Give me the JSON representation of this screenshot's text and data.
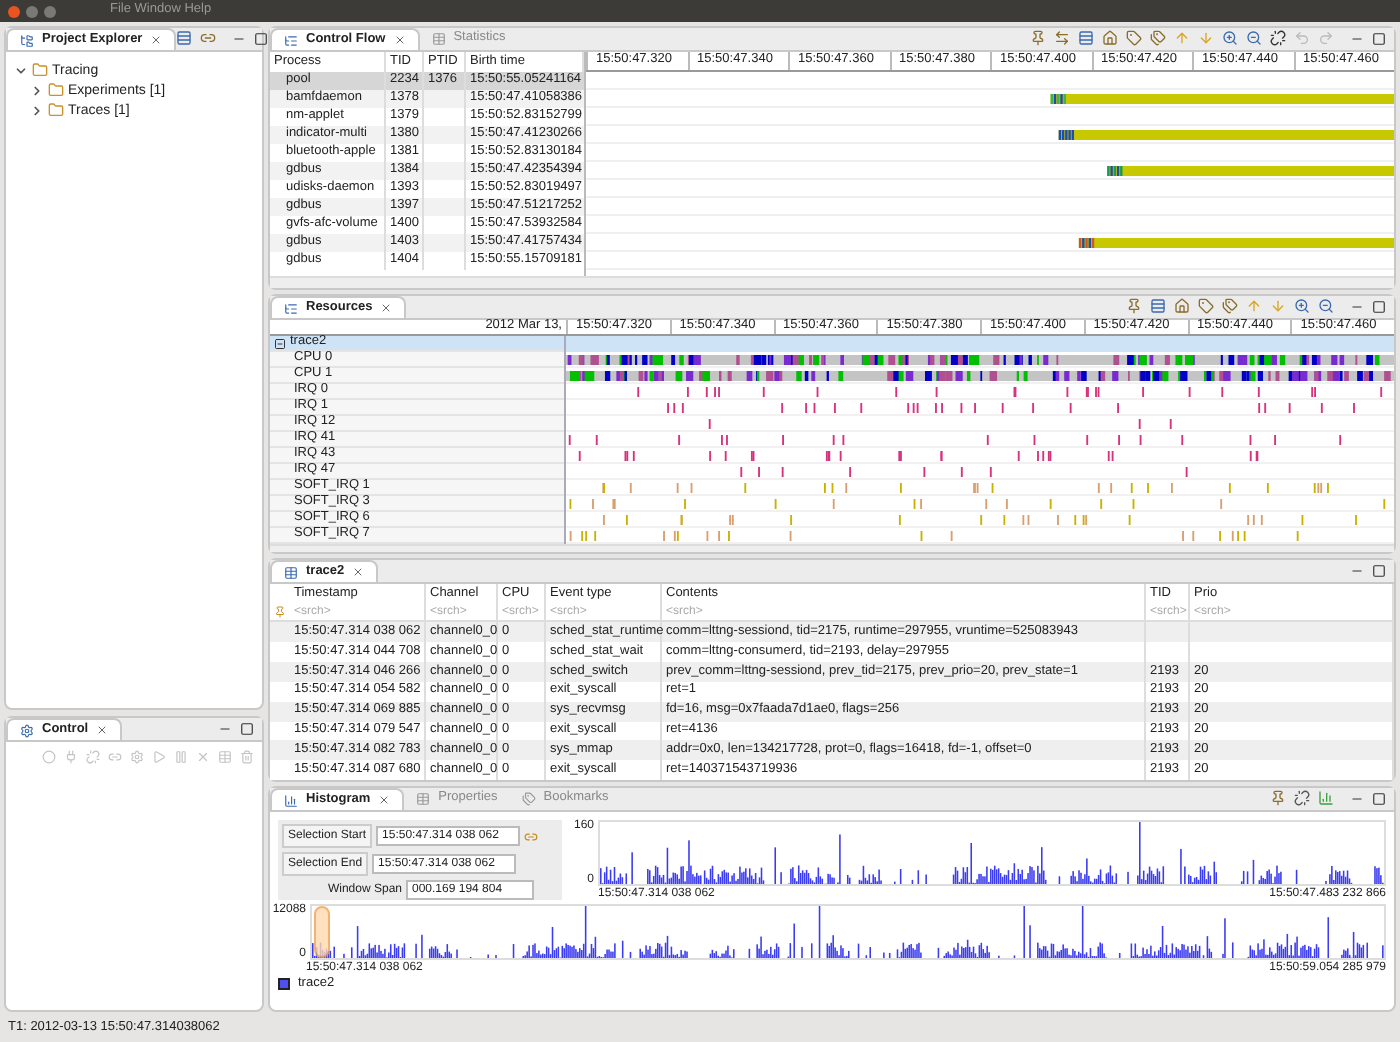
{
  "window": {
    "title": "File Window Help"
  },
  "project_explorer": {
    "title": "Project Explorer",
    "tree": [
      {
        "label": "Tracing",
        "expanded": true,
        "children": [
          {
            "label": "Experiments [1]",
            "expanded": false
          },
          {
            "label": "Traces [1]",
            "expanded": false
          }
        ]
      }
    ]
  },
  "control_view": {
    "title": "Control"
  },
  "control_flow": {
    "tabs": [
      {
        "label": "Control Flow",
        "selected": true
      },
      {
        "label": "Statistics",
        "selected": false
      }
    ],
    "columns": [
      "Process",
      "TID",
      "PTID",
      "Birth time"
    ],
    "rows": [
      {
        "process": "pool",
        "tid": "2234",
        "ptid": "1376",
        "birth": "15:50:55.05241164",
        "selected": true
      },
      {
        "process": "bamfdaemon",
        "tid": "1378",
        "birth": "15:50:47.41058386",
        "selected": false
      },
      {
        "process": "nm-applet",
        "tid": "1379",
        "birth": "15:50:52.83152799",
        "selected": false
      },
      {
        "process": "indicator-multi",
        "tid": "1380",
        "birth": "15:50:47.41230266",
        "selected": false
      },
      {
        "process": "bluetooth-apple",
        "tid": "1381",
        "birth": "15:50:52.83130184",
        "selected": false
      },
      {
        "process": "gdbus",
        "tid": "1384",
        "birth": "15:50:47.42354394",
        "selected": false
      },
      {
        "process": "udisks-daemon",
        "tid": "1393",
        "birth": "15:50:52.83019497",
        "selected": false
      },
      {
        "process": "gdbus",
        "tid": "1397",
        "birth": "15:50:47.51217252",
        "selected": false
      },
      {
        "process": "gvfs-afc-volume",
        "tid": "1400",
        "birth": "15:50:47.53932584",
        "selected": false
      },
      {
        "process": "gdbus",
        "tid": "1403",
        "birth": "15:50:47.41757434",
        "selected": false
      },
      {
        "process": "gdbus",
        "tid": "1404",
        "birth": "15:50:55.15709181",
        "selected": false
      }
    ],
    "time_axis": [
      "15:50:47.320",
      "15:50:47.340",
      "15:50:47.360",
      "15:50:47.380",
      "15:50:47.400",
      "15:50:47.420",
      "15:50:47.440",
      "15:50:47.460"
    ]
  },
  "resources": {
    "title": "Resources",
    "date_label": "2012 Mar 13,",
    "time_axis": [
      "15:50:47.320",
      "15:50:47.340",
      "15:50:47.360",
      "15:50:47.380",
      "15:50:47.400",
      "15:50:47.420",
      "15:50:47.440",
      "15:50:47.460"
    ],
    "rows": [
      {
        "label": "trace2",
        "kind": "group",
        "expanded": true,
        "selected": true
      },
      {
        "label": "CPU 0",
        "kind": "cpu",
        "selected": false
      },
      {
        "label": "CPU 1",
        "kind": "cpu",
        "selected": false
      },
      {
        "label": "IRQ 0",
        "kind": "irq",
        "selected": false
      },
      {
        "label": "IRQ 1",
        "kind": "irq",
        "selected": false
      },
      {
        "label": "IRQ 12",
        "kind": "irq",
        "selected": false
      },
      {
        "label": "IRQ 41",
        "kind": "irq",
        "selected": false
      },
      {
        "label": "IRQ 43",
        "kind": "irq",
        "selected": false
      },
      {
        "label": "IRQ 47",
        "kind": "irq",
        "selected": false
      },
      {
        "label": "SOFT_IRQ 1",
        "kind": "soft_irq",
        "selected": false
      },
      {
        "label": "SOFT_IRQ 3",
        "kind": "soft_irq",
        "selected": false
      },
      {
        "label": "SOFT_IRQ 6",
        "kind": "soft_irq",
        "selected": false
      },
      {
        "label": "SOFT_IRQ 7",
        "kind": "soft_irq",
        "selected": false
      }
    ]
  },
  "events": {
    "title": "trace2",
    "columns": [
      "Timestamp",
      "Channel",
      "CPU",
      "Event type",
      "Contents",
      "TID",
      "Prio"
    ],
    "filters": [
      {
        "placeholder": "<srch>"
      },
      {
        "placeholder": "<srch>"
      },
      {
        "placeholder": "<srch>"
      },
      {
        "placeholder": "<srch>"
      },
      {
        "placeholder": "<srch>"
      },
      {
        "placeholder": "<srch>"
      },
      {
        "placeholder": "<srch>"
      }
    ],
    "rows": [
      {
        "timestamp": "15:50:47.314 038 062",
        "channel": "channel0_0",
        "cpu": "0",
        "event_type": "sched_stat_runtime",
        "contents": "comm=lttng-sessiond, tid=2175, runtime=297955, vruntime=525083943"
      },
      {
        "timestamp": "15:50:47.314 044 708",
        "channel": "channel0_0",
        "cpu": "0",
        "event_type": "sched_stat_wait",
        "contents": "comm=lttng-consumerd, tid=2193, delay=297955"
      },
      {
        "timestamp": "15:50:47.314 046 266",
        "channel": "channel0_0",
        "cpu": "0",
        "event_type": "sched_switch",
        "contents": "prev_comm=lttng-sessiond, prev_tid=2175, prev_prio=20, prev_state=1",
        "tid": "2193",
        "prio": "20"
      },
      {
        "timestamp": "15:50:47.314 054 582",
        "channel": "channel0_0",
        "cpu": "0",
        "event_type": "exit_syscall",
        "contents": "ret=1",
        "tid": "2193",
        "prio": "20"
      },
      {
        "timestamp": "15:50:47.314 069 885",
        "channel": "channel0_0",
        "cpu": "0",
        "event_type": "sys_recvmsg",
        "contents": "fd=16, msg=0x7faada7d1ae0, flags=256",
        "tid": "2193",
        "prio": "20"
      },
      {
        "timestamp": "15:50:47.314 079 547",
        "channel": "channel0_0",
        "cpu": "0",
        "event_type": "exit_syscall",
        "contents": "ret=4136",
        "tid": "2193",
        "prio": "20"
      },
      {
        "timestamp": "15:50:47.314 082 783",
        "channel": "channel0_0",
        "cpu": "0",
        "event_type": "sys_mmap",
        "contents": "addr=0x0, len=134217728, prot=0, flags=16418, fd=-1, offset=0",
        "tid": "2193",
        "prio": "20"
      },
      {
        "timestamp": "15:50:47.314 087 680",
        "channel": "channel0_0",
        "cpu": "0",
        "event_type": "exit_syscall",
        "contents": "ret=140371543719936",
        "tid": "2193",
        "prio": "20"
      }
    ]
  },
  "histogram": {
    "tabs": [
      {
        "label": "Histogram",
        "selected": true
      },
      {
        "label": "Properties",
        "selected": false
      },
      {
        "label": "Bookmarks",
        "selected": false
      }
    ],
    "selection_start_label": "Selection Start",
    "selection_start": "15:50:47.314 038 062",
    "selection_end_label": "Selection End",
    "selection_end": "15:50:47.314 038 062",
    "window_span_label": "Window Span",
    "window_span": "000.169 194 804",
    "top_max": "160",
    "top_min": "0",
    "top_start": "15:50:47.314 038 062",
    "top_end": "15:50:47.483 232 866",
    "bottom_max": "12088",
    "bottom_min": "0",
    "bottom_start": "15:50:47.314 038 062",
    "bottom_end": "15:50:59.054 285 979",
    "legend": "trace2"
  },
  "status_bar": "T1: 2012-03-13 15:50:47.314038062"
}
